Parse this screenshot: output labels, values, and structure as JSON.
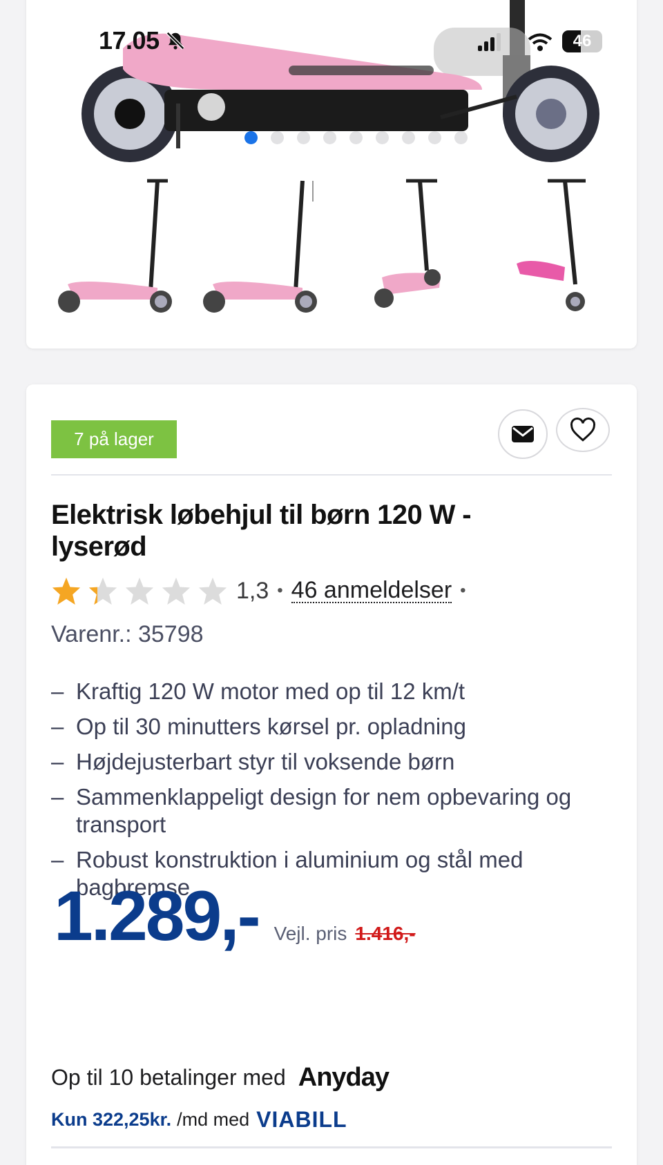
{
  "status_bar": {
    "time": "17.05",
    "battery": "46"
  },
  "gallery": {
    "dots_count": 9,
    "active_dot_index": 0,
    "thumbnails": [
      "scooter-side-view",
      "scooter-side-view-adjust",
      "scooter-three-quarter-view",
      "scooter-front-three-quarter-view"
    ]
  },
  "product": {
    "stock_label": "7 på lager",
    "title": "Elektrisk løbehjul til børn 120 W - lyserød",
    "rating_value": "1,3",
    "rating_fraction": 0.26,
    "reviews_label": "46 anmeldelser",
    "sku_label": "Varenr.: 35798",
    "features": [
      "Kraftig 120 W motor med op til 12 km/t",
      "Op til 30 minutters kørsel pr. opladning",
      "Højdejusterbart styr til voksende børn",
      "Sammenklappeligt design for nem opbevaring og transport",
      "Robust konstruktion i aluminium og stål med bagbremse"
    ],
    "feature_dash": "–",
    "price": "1.289,-",
    "rrp_label": "Vejl. pris",
    "rrp_value": "1.416,-"
  },
  "payment": {
    "anyday_text": "Op til 10 betalinger med",
    "anyday_logo": "Anyday",
    "viabill_amount": "Kun 322,25kr.",
    "viabill_text": "/md med",
    "viabill_logo": "VIABILL"
  },
  "icons": {
    "mail": "envelope-icon",
    "favorite": "heart-icon",
    "mute": "bell-slash-icon"
  },
  "colors": {
    "accent_blue": "#0b3c8c",
    "stock_green": "#7dc242",
    "star_gold": "#f5a623",
    "rrp_red": "#d11a1a",
    "scooter_pink": "#f0a8c8"
  }
}
